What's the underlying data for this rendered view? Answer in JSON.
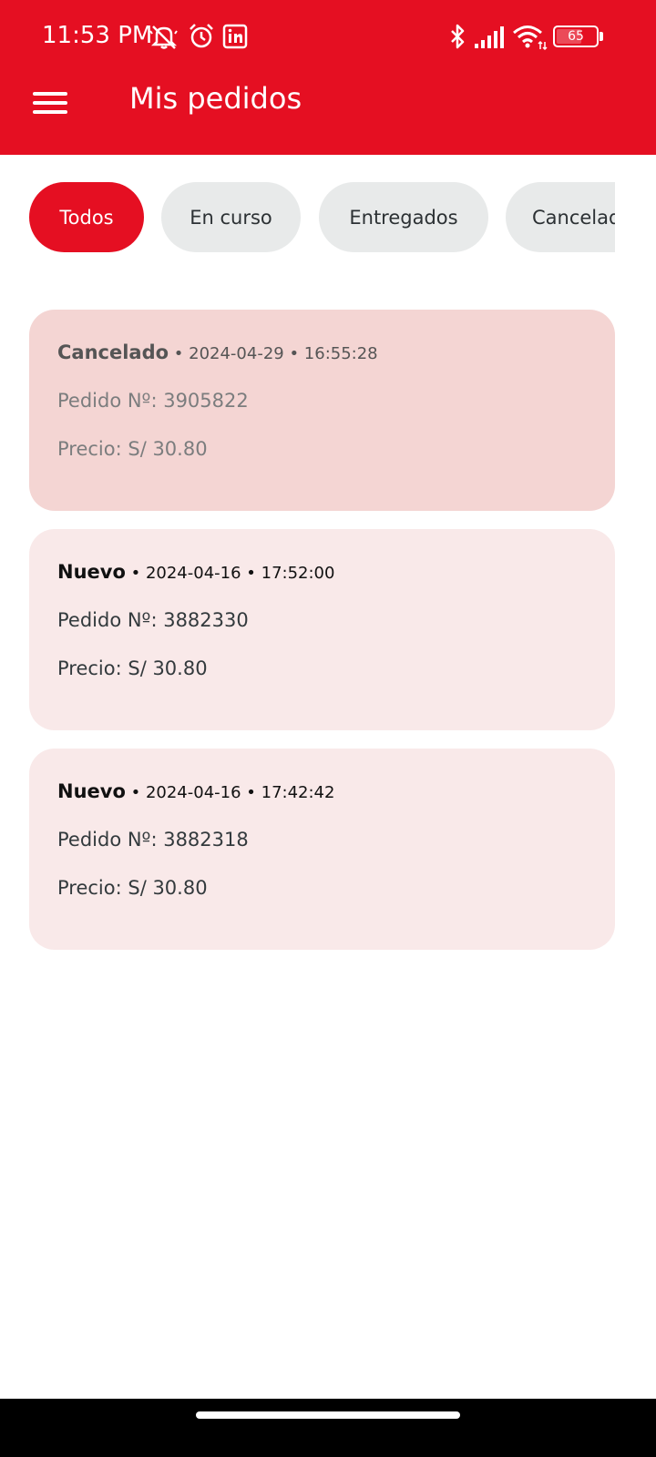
{
  "status_bar": {
    "time": "11:53 PM",
    "battery": "65",
    "battery_level": 0.65,
    "icons": [
      "bell-off-icon",
      "alarm-icon",
      "linkedin-icon",
      "bluetooth-icon",
      "signal-icon",
      "wifi-icon",
      "battery-icon"
    ]
  },
  "header": {
    "title": "Mis pedidos",
    "menu_icon": "hamburger-menu-icon"
  },
  "filters": {
    "selected": "Todos",
    "items": [
      {
        "label": "Todos"
      },
      {
        "label": "En curso"
      },
      {
        "label": "Entregados"
      },
      {
        "label": "Cancelados"
      }
    ]
  },
  "orders": [
    {
      "status": "Cancelado",
      "meta": " • 2024-04-29 • 16:55:28",
      "order_no": "Pedido Nº: 3905822",
      "price": "Precio: S/ 30.80"
    },
    {
      "status": "Nuevo",
      "meta": " • 2024-04-16 • 17:52:00",
      "order_no": "Pedido Nº: 3882330",
      "price": "Precio: S/ 30.80"
    },
    {
      "status": "Nuevo",
      "meta": " • 2024-04-16 • 17:42:42",
      "order_no": "Pedido Nº: 3882318",
      "price": "Precio: S/ 30.80"
    }
  ],
  "colors": {
    "brand_red": "#e50f22",
    "chip_inactive": "#e8eaea",
    "card_new": "#f9e9e9",
    "card_cancelled": "#f4d5d3"
  }
}
